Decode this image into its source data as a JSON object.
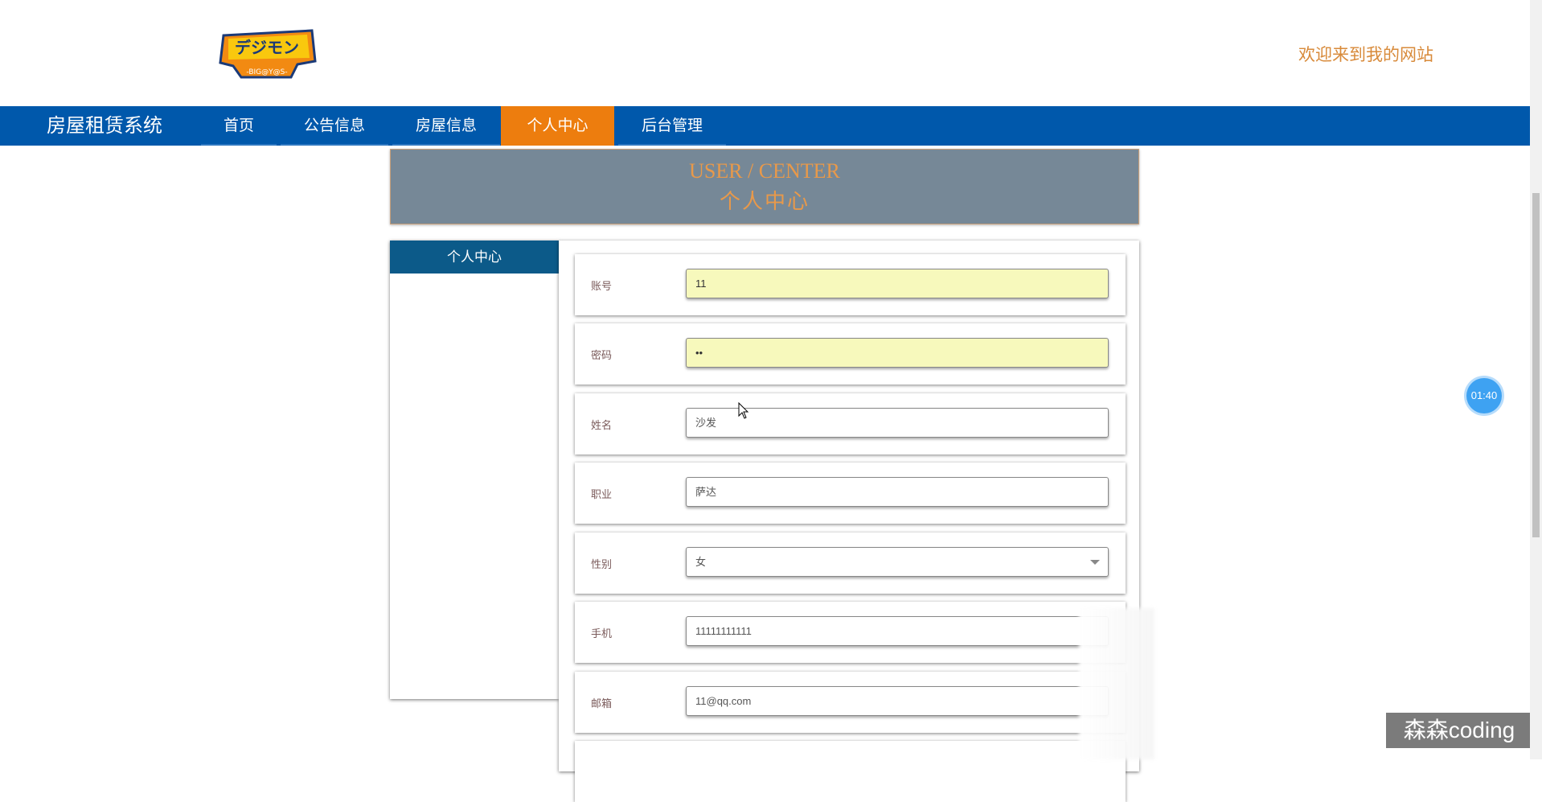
{
  "header": {
    "logo": {
      "text_top": "デジモン",
      "text_bottom": "-BIG@Y@S-",
      "colors": [
        "#f9c80e",
        "#f28a12",
        "#1b3a78"
      ]
    },
    "welcome_text": "欢迎来到我的网站"
  },
  "navbar": {
    "brand": "房屋租赁系统",
    "bg_color": "#0058ab",
    "active_color": "#ed7d0e",
    "items": [
      {
        "label": "首页"
      },
      {
        "label": "公告信息"
      },
      {
        "label": "房屋信息"
      },
      {
        "label": "个人中心",
        "active": true
      },
      {
        "label": "后台管理"
      }
    ]
  },
  "banner": {
    "title_en": "USER / CENTER",
    "title_cn": "个人中心"
  },
  "sidebar": {
    "heading": "个人中心"
  },
  "form": {
    "fields": [
      {
        "label": "账号",
        "value": "11",
        "type": "text",
        "autofilled": true
      },
      {
        "label": "密码",
        "value": "••",
        "type": "password",
        "autofilled": true
      },
      {
        "label": "姓名",
        "value": "沙发",
        "type": "text"
      },
      {
        "label": "职业",
        "value": "萨达",
        "type": "text"
      },
      {
        "label": "性别",
        "value": "女",
        "type": "select"
      },
      {
        "label": "手机",
        "value": "11111111111",
        "type": "text"
      },
      {
        "label": "邮箱",
        "value": "11@qq.com",
        "type": "text"
      }
    ]
  },
  "overlay": {
    "timer": "01:40",
    "watermark": "森森coding"
  }
}
